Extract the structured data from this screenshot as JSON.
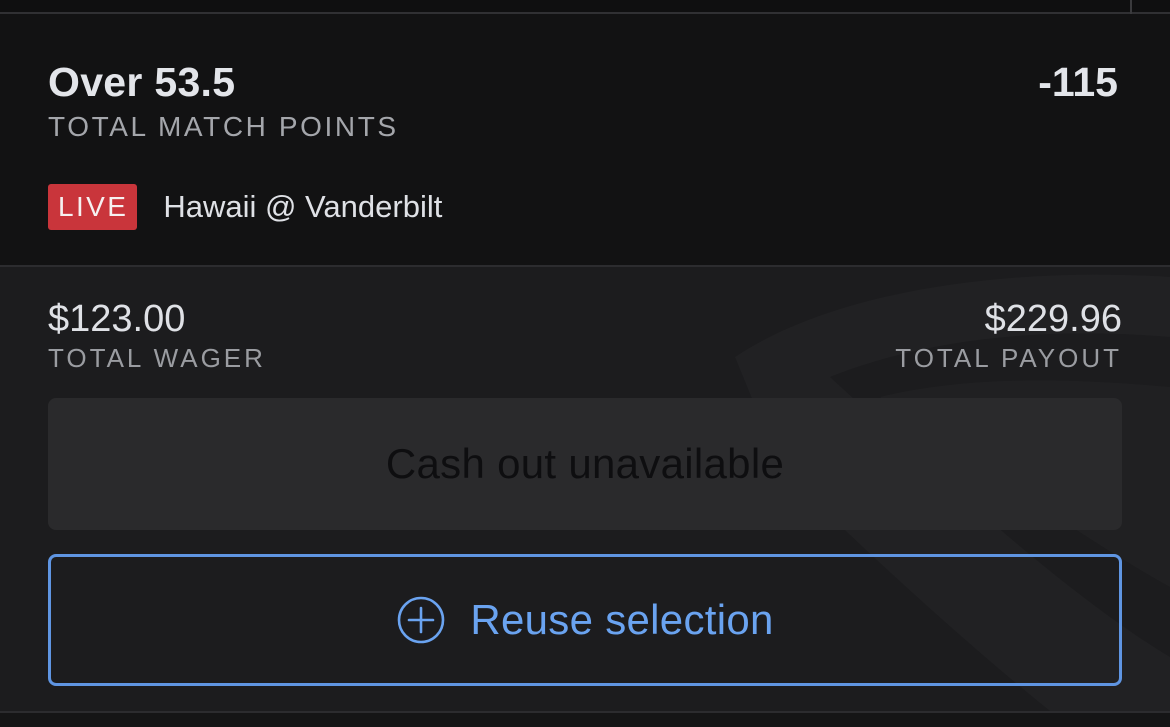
{
  "selection": {
    "title": "Over 53.5",
    "odds": "-115",
    "market": "TOTAL MATCH POINTS",
    "live_badge": "LIVE",
    "event": "Hawaii @ Vanderbilt"
  },
  "wager": {
    "total_wager_amount": "$123.00",
    "total_wager_label": "TOTAL WAGER",
    "total_payout_amount": "$229.96",
    "total_payout_label": "TOTAL PAYOUT"
  },
  "actions": {
    "cashout_label": "Cash out unavailable",
    "reuse_label": "Reuse selection",
    "reuse_icon": "plus-circle-icon"
  },
  "colors": {
    "live_badge": "#c9353b",
    "accent_blue": "#6aa3f0",
    "background": "#121213",
    "panel": "#1c1c1e"
  }
}
